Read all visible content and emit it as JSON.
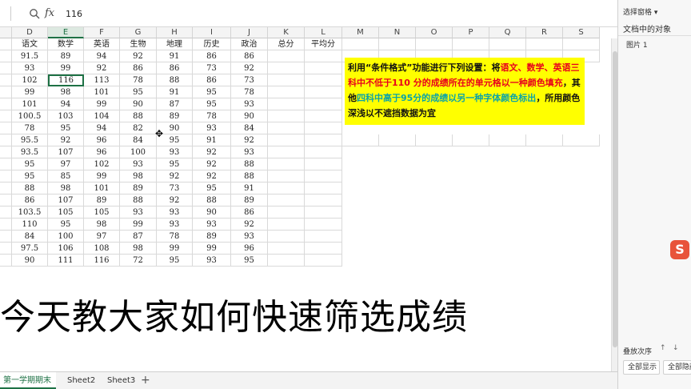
{
  "formula_bar": {
    "zoom_icon": "zoom-icon",
    "fx_label": "fx",
    "value": "116"
  },
  "columns": [
    "D",
    "E",
    "F",
    "G",
    "H",
    "I",
    "J",
    "K",
    "L",
    "M",
    "N",
    "O",
    "P",
    "Q",
    "R",
    "S"
  ],
  "header_row": [
    "语文",
    "数学",
    "英语",
    "生物",
    "地理",
    "历史",
    "政治",
    "总分",
    "平均分"
  ],
  "rows": [
    [
      "91.5",
      "89",
      "94",
      "92",
      "91",
      "86",
      "86"
    ],
    [
      "93",
      "99",
      "92",
      "86",
      "86",
      "73",
      "92"
    ],
    [
      "102",
      "116",
      "113",
      "78",
      "88",
      "86",
      "73"
    ],
    [
      "99",
      "98",
      "101",
      "95",
      "91",
      "95",
      "78"
    ],
    [
      "101",
      "94",
      "99",
      "90",
      "87",
      "95",
      "93"
    ],
    [
      "100.5",
      "103",
      "104",
      "88",
      "89",
      "78",
      "90"
    ],
    [
      "78",
      "95",
      "94",
      "82",
      "90",
      "93",
      "84"
    ],
    [
      "95.5",
      "92",
      "96",
      "84",
      "95",
      "91",
      "92"
    ],
    [
      "93.5",
      "107",
      "96",
      "100",
      "93",
      "92",
      "93"
    ],
    [
      "95",
      "97",
      "102",
      "93",
      "95",
      "92",
      "88"
    ],
    [
      "95",
      "85",
      "99",
      "98",
      "92",
      "92",
      "88"
    ],
    [
      "88",
      "98",
      "101",
      "89",
      "73",
      "95",
      "91"
    ],
    [
      "86",
      "107",
      "89",
      "88",
      "92",
      "88",
      "89"
    ],
    [
      "103.5",
      "105",
      "105",
      "93",
      "93",
      "90",
      "86"
    ],
    [
      "110",
      "95",
      "98",
      "99",
      "93",
      "93",
      "92"
    ],
    [
      "84",
      "100",
      "97",
      "87",
      "78",
      "89",
      "93"
    ],
    [
      "97.5",
      "106",
      "108",
      "98",
      "99",
      "99",
      "96"
    ],
    [
      "90",
      "111",
      "116",
      "72",
      "95",
      "93",
      "95"
    ]
  ],
  "note": {
    "p1": "利用“条件格式”功能进行下列设置：将",
    "p2": "语文、数学、英语三科中不低于110 分的成绩所在的单元格以一种颜色填充",
    "p3": "，其他",
    "p4": "四科中高于95分的成绩以另一种字体颜色标出",
    "p5": "，所用颜色深浅以不遮挡数据为宜"
  },
  "subtitle": "今天教大家如何快速筛选成绩",
  "tabs": [
    "第一学期期末成绩",
    "Sheet2",
    "Sheet3"
  ],
  "tab_add": "+",
  "pane": {
    "title": "选择窗格 ▾",
    "subtitle": "文档中的对象",
    "item": "图片 1",
    "order_label": "叠放次序",
    "up": "↑",
    "down": "↓",
    "show_all": "全部显示",
    "hide_all": "全部隐藏"
  },
  "logo_letter": "S",
  "cursor_glyph": "✥",
  "colors": {
    "accent": "#1e7145",
    "note_bg": "#ffff00",
    "note_red": "#e8001c",
    "note_teal": "#0aa3a8",
    "logo": "#e8533a"
  }
}
